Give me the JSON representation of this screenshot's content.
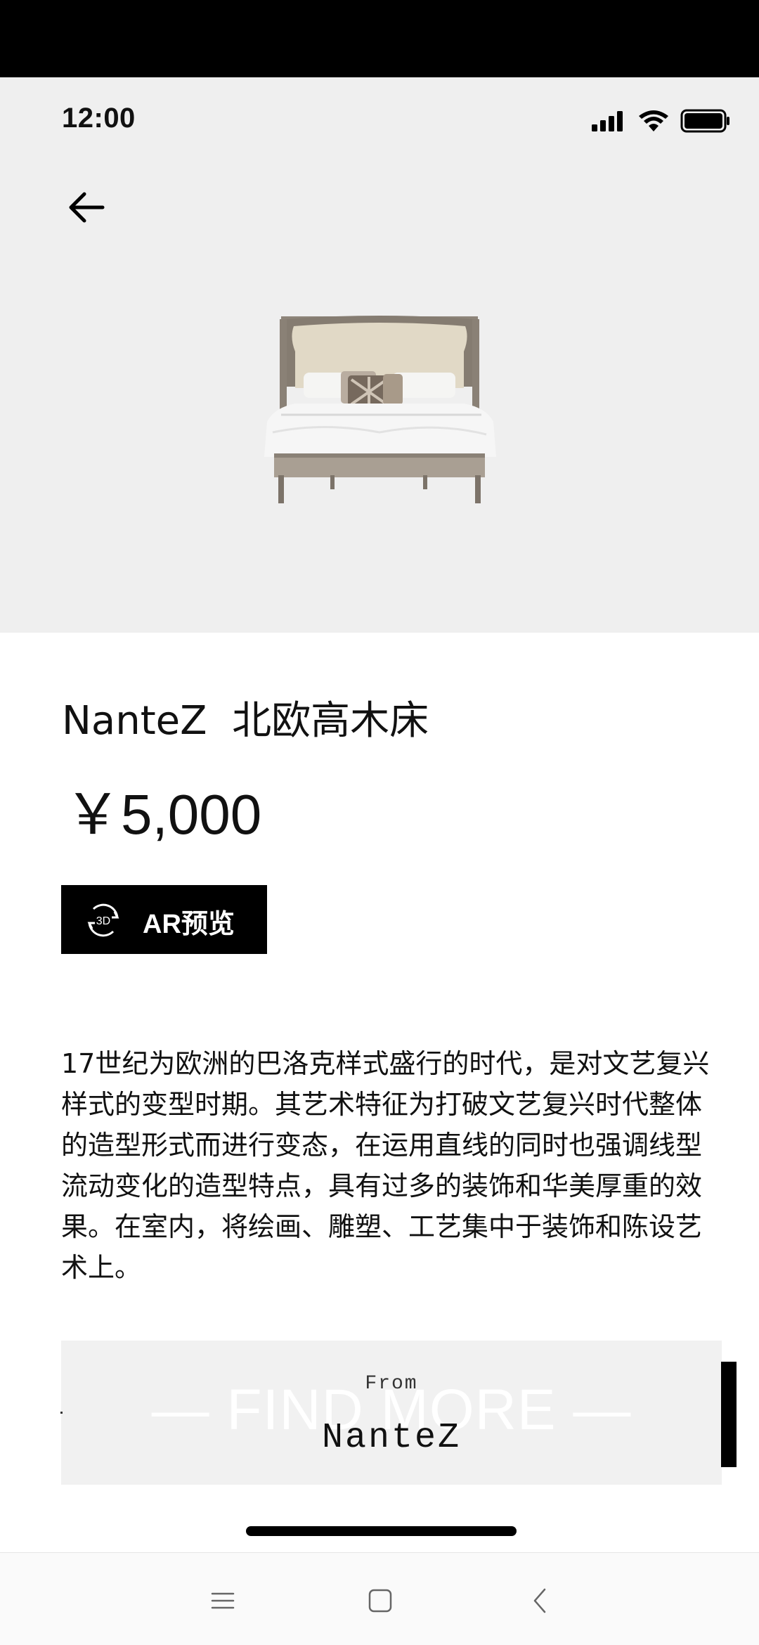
{
  "status_bar": {
    "time": "12:00"
  },
  "header": {
    "back_icon": "arrow-left-icon"
  },
  "product": {
    "image": "bed-product-image",
    "title": "NanteZ  北欧高木床",
    "price": "￥5,000",
    "ar_button": {
      "icon": "3d-rotate-icon",
      "icon_text": "3D",
      "label": "AR预览"
    },
    "description": "17世纪为欧洲的巴洛克样式盛行的时代，是对文艺复兴样式的变型时期。其艺术特征为打破文艺复兴时代整体的造型形式而进行变态，在运用直线的同时也强调线型流动变化的造型特点，具有过多的装饰和华美厚重的效果。在室内，将绘画、雕塑、工艺集中于装饰和陈设艺术上。"
  },
  "promo": {
    "overlay_text": "— FIND MORE —",
    "from_label": "From",
    "brand": "NanteZ"
  },
  "nav_bar": {
    "menu_icon": "menu-icon",
    "home_icon": "square-home-icon",
    "back_icon": "chevron-left-icon"
  },
  "colors": {
    "hero_background": "#efefef",
    "button_background": "#000000",
    "promo_background": "#f1f1f1"
  }
}
